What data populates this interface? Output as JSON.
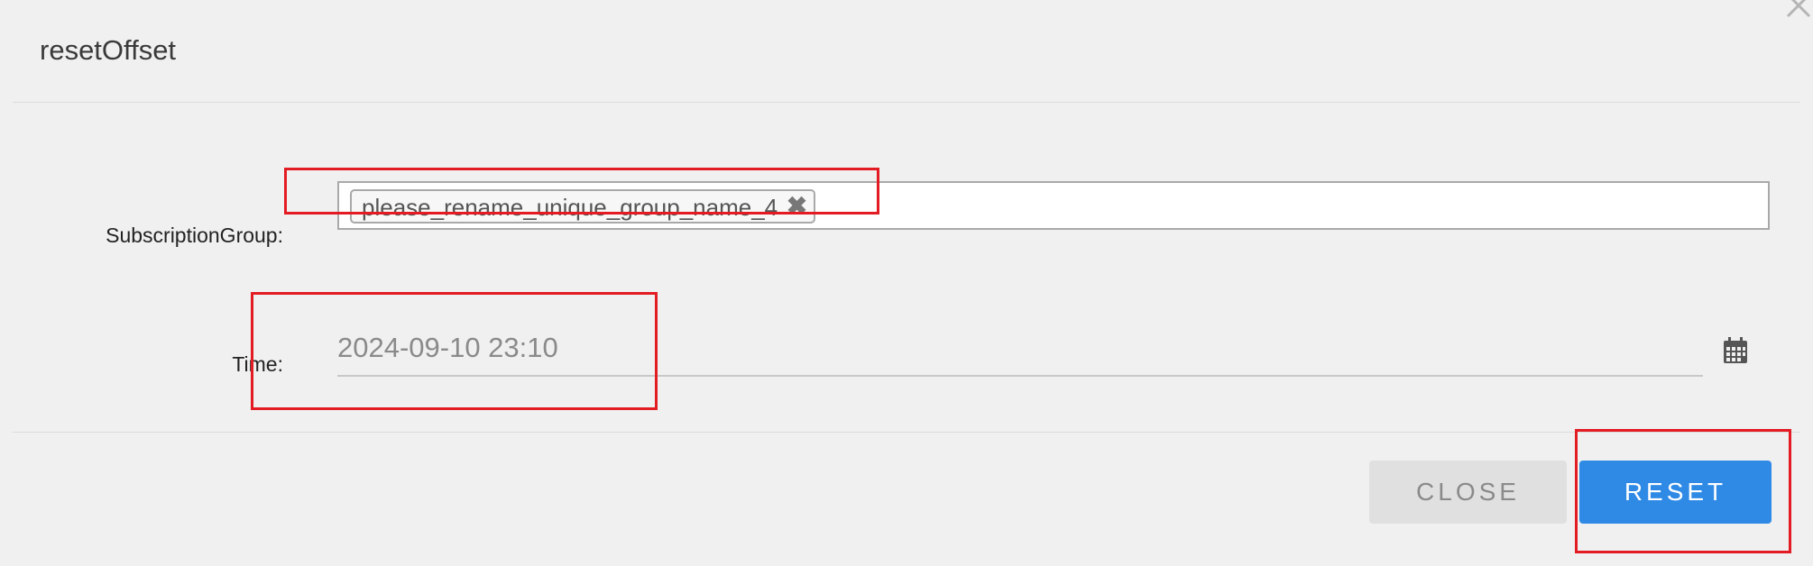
{
  "dialog": {
    "title": "resetOffset",
    "close_icon": "close-icon"
  },
  "form": {
    "subscription_group": {
      "label": "SubscriptionGroup:",
      "tags": [
        "please_rename_unique_group_name_4"
      ],
      "tag_remove_glyph": "✖"
    },
    "time": {
      "label": "Time:",
      "value": "2024-09-10 23:10",
      "icon": "calendar-icon"
    }
  },
  "footer": {
    "close_label": "CLOSE",
    "reset_label": "RESET"
  },
  "colors": {
    "primary": "#2f8ae6",
    "secondary_button": "#e0e0e0",
    "annotation": "#e31b23",
    "background": "#f0f0f0"
  }
}
